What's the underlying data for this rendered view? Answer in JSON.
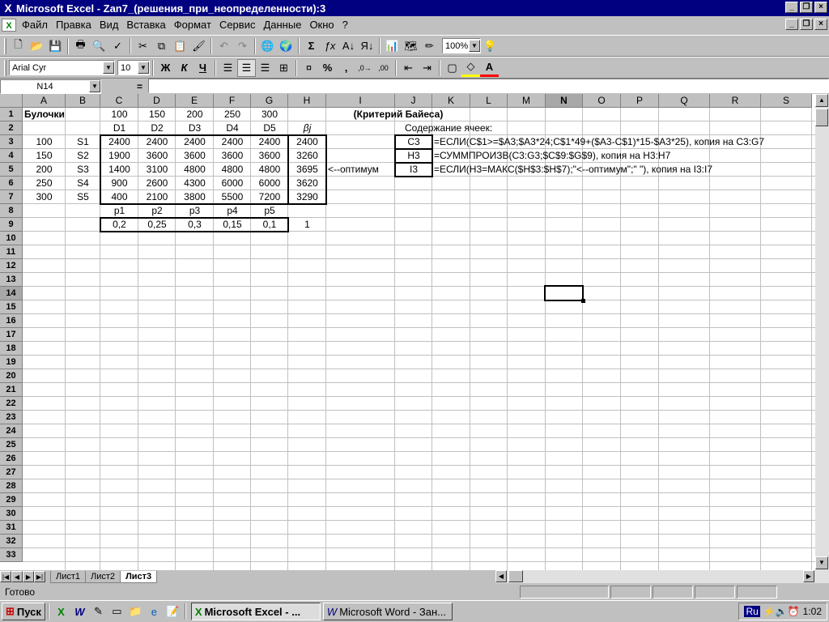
{
  "title": "Microsoft Excel - Zan7_(решения_при_неопределенности):3",
  "menu": [
    "Файл",
    "Правка",
    "Вид",
    "Вставка",
    "Формат",
    "Сервис",
    "Данные",
    "Окно",
    "?"
  ],
  "font_name": "Arial Cyr",
  "font_size": "10",
  "zoom": "100%",
  "name_box": "N14",
  "formula_eq": "=",
  "columns": [
    {
      "letter": "A"
    },
    {
      "letter": "B"
    },
    {
      "letter": "C"
    },
    {
      "letter": "D"
    },
    {
      "letter": "E"
    },
    {
      "letter": "F"
    },
    {
      "letter": "G"
    },
    {
      "letter": "H"
    },
    {
      "letter": "I"
    },
    {
      "letter": "J"
    },
    {
      "letter": "K"
    },
    {
      "letter": "L"
    },
    {
      "letter": "M"
    },
    {
      "letter": "N"
    },
    {
      "letter": "O"
    },
    {
      "letter": "P"
    },
    {
      "letter": "Q"
    },
    {
      "letter": "R"
    },
    {
      "letter": "S"
    }
  ],
  "selected_col": "N",
  "selected_row": 14,
  "cells": [
    {
      "col": "A",
      "row": 1,
      "text": "Булочки",
      "align": "left",
      "bold": true
    },
    {
      "col": "C",
      "row": 1,
      "text": "100"
    },
    {
      "col": "D",
      "row": 1,
      "text": "150"
    },
    {
      "col": "E",
      "row": 1,
      "text": "200"
    },
    {
      "col": "F",
      "row": 1,
      "text": "250"
    },
    {
      "col": "G",
      "row": 1,
      "text": "300"
    },
    {
      "col": "I",
      "row": 1,
      "text": "(Критерий Байеса)",
      "bold": true,
      "span": "I-K"
    },
    {
      "col": "C",
      "row": 2,
      "text": "D1"
    },
    {
      "col": "D",
      "row": 2,
      "text": "D2"
    },
    {
      "col": "E",
      "row": 2,
      "text": "D3"
    },
    {
      "col": "F",
      "row": 2,
      "text": "D4"
    },
    {
      "col": "G",
      "row": 2,
      "text": "D5"
    },
    {
      "col": "H",
      "row": 2,
      "text": "βj",
      "italic": true
    },
    {
      "col": "J",
      "row": 2,
      "text": "Содержание ячеек:",
      "align": "left",
      "span": "J-L"
    },
    {
      "col": "A",
      "row": 3,
      "text": "100"
    },
    {
      "col": "B",
      "row": 3,
      "text": "S1"
    },
    {
      "col": "C",
      "row": 3,
      "text": "2400"
    },
    {
      "col": "D",
      "row": 3,
      "text": "2400"
    },
    {
      "col": "E",
      "row": 3,
      "text": "2400"
    },
    {
      "col": "F",
      "row": 3,
      "text": "2400"
    },
    {
      "col": "G",
      "row": 3,
      "text": "2400"
    },
    {
      "col": "H",
      "row": 3,
      "text": "2400"
    },
    {
      "col": "J",
      "row": 3,
      "text": "C3"
    },
    {
      "col": "K",
      "row": 3,
      "text": "=ЕСЛИ(C$1>=$A3;$A3*24;C$1*49+($A3-C$1)*15-$A3*25), копия на C3:G7",
      "align": "left"
    },
    {
      "col": "A",
      "row": 4,
      "text": "150"
    },
    {
      "col": "B",
      "row": 4,
      "text": "S2"
    },
    {
      "col": "C",
      "row": 4,
      "text": "1900"
    },
    {
      "col": "D",
      "row": 4,
      "text": "3600"
    },
    {
      "col": "E",
      "row": 4,
      "text": "3600"
    },
    {
      "col": "F",
      "row": 4,
      "text": "3600"
    },
    {
      "col": "G",
      "row": 4,
      "text": "3600"
    },
    {
      "col": "H",
      "row": 4,
      "text": "3260"
    },
    {
      "col": "J",
      "row": 4,
      "text": "H3"
    },
    {
      "col": "K",
      "row": 4,
      "text": "=СУММПРОИЗВ(C3:G3;$C$9:$G$9), копия на H3:H7",
      "align": "left"
    },
    {
      "col": "A",
      "row": 5,
      "text": "200"
    },
    {
      "col": "B",
      "row": 5,
      "text": "S3"
    },
    {
      "col": "C",
      "row": 5,
      "text": "1400"
    },
    {
      "col": "D",
      "row": 5,
      "text": "3100"
    },
    {
      "col": "E",
      "row": 5,
      "text": "4800"
    },
    {
      "col": "F",
      "row": 5,
      "text": "4800"
    },
    {
      "col": "G",
      "row": 5,
      "text": "4800"
    },
    {
      "col": "H",
      "row": 5,
      "text": "3695"
    },
    {
      "col": "I",
      "row": 5,
      "text": "<--оптимум",
      "align": "left"
    },
    {
      "col": "J",
      "row": 5,
      "text": "I3"
    },
    {
      "col": "K",
      "row": 5,
      "text": "=ЕСЛИ(H3=МАКС($H$3:$H$7);\"<--оптимум\";\" \"), копия на I3:I7",
      "align": "left"
    },
    {
      "col": "A",
      "row": 6,
      "text": "250"
    },
    {
      "col": "B",
      "row": 6,
      "text": "S4"
    },
    {
      "col": "C",
      "row": 6,
      "text": "900"
    },
    {
      "col": "D",
      "row": 6,
      "text": "2600"
    },
    {
      "col": "E",
      "row": 6,
      "text": "4300"
    },
    {
      "col": "F",
      "row": 6,
      "text": "6000"
    },
    {
      "col": "G",
      "row": 6,
      "text": "6000"
    },
    {
      "col": "H",
      "row": 6,
      "text": "3620"
    },
    {
      "col": "A",
      "row": 7,
      "text": "300"
    },
    {
      "col": "B",
      "row": 7,
      "text": "S5"
    },
    {
      "col": "C",
      "row": 7,
      "text": "400"
    },
    {
      "col": "D",
      "row": 7,
      "text": "2100"
    },
    {
      "col": "E",
      "row": 7,
      "text": "3800"
    },
    {
      "col": "F",
      "row": 7,
      "text": "5500"
    },
    {
      "col": "G",
      "row": 7,
      "text": "7200"
    },
    {
      "col": "H",
      "row": 7,
      "text": "3290"
    },
    {
      "col": "C",
      "row": 8,
      "text": "p1"
    },
    {
      "col": "D",
      "row": 8,
      "text": "p2"
    },
    {
      "col": "E",
      "row": 8,
      "text": "p3"
    },
    {
      "col": "F",
      "row": 8,
      "text": "p4"
    },
    {
      "col": "G",
      "row": 8,
      "text": "p5"
    },
    {
      "col": "C",
      "row": 9,
      "text": "0,2"
    },
    {
      "col": "D",
      "row": 9,
      "text": "0,25"
    },
    {
      "col": "E",
      "row": 9,
      "text": "0,3"
    },
    {
      "col": "F",
      "row": 9,
      "text": "0,15"
    },
    {
      "col": "G",
      "row": 9,
      "text": "0,1"
    },
    {
      "col": "H",
      "row": 9,
      "text": "1"
    }
  ],
  "sheets": [
    "Лист1",
    "Лист2",
    "Лист3"
  ],
  "active_sheet": "Лист3",
  "status": "Готово",
  "taskbar": {
    "start": "Пуск",
    "tasks": [
      "Microsoft Excel - ...",
      "Microsoft Word - Зан..."
    ],
    "lang": "Ru",
    "clock": "1:02"
  }
}
